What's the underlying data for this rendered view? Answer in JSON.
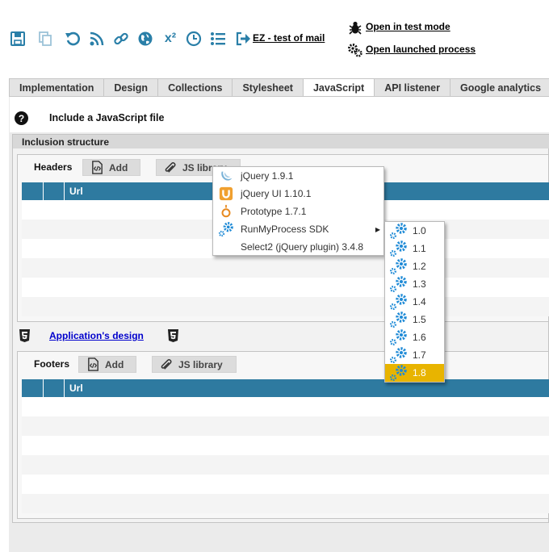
{
  "toolbar": {
    "icons": [
      "save-icon",
      "copy-icon",
      "undo-icon",
      "rss-icon",
      "link-icon",
      "globe-icon",
      "superscript-icon",
      "clock-icon",
      "list-icon",
      "export-icon"
    ],
    "superscript_label": "x²",
    "mail_link": "EZ - test of mail",
    "test_mode_link": "Open in test mode",
    "launched_process_link": "Open launched process",
    "icon_color": "#2a7fa8"
  },
  "tabs": [
    {
      "label": "Implementation"
    },
    {
      "label": "Design"
    },
    {
      "label": "Collections"
    },
    {
      "label": "Stylesheet"
    },
    {
      "label": "JavaScript",
      "active": true
    },
    {
      "label": "API listener"
    },
    {
      "label": "Google analytics"
    }
  ],
  "main": {
    "help_glyph": "?",
    "title": "Include a JavaScript file",
    "inclusion_header": "Inclusion structure",
    "headers": {
      "label": "Headers",
      "add_label": "Add",
      "js_library_label": "JS library",
      "column_url": "Url"
    },
    "design_link": "Application's design",
    "footers": {
      "label": "Footers",
      "add_label": "Add",
      "js_library_label": "JS library",
      "column_url": "Url"
    }
  },
  "menu": {
    "items": [
      {
        "label": "jQuery 1.9.1",
        "icon": "jquery-icon"
      },
      {
        "label": "jQuery UI 1.10.1",
        "icon": "jquery-ui-icon"
      },
      {
        "label": "Prototype 1.7.1",
        "icon": "prototype-icon"
      },
      {
        "label": "RunMyProcess SDK",
        "icon": "gears-icon",
        "has_submenu": true
      },
      {
        "label": "Select2 (jQuery plugin) 3.4.8",
        "icon": ""
      }
    ],
    "submenu": [
      {
        "label": "1.0"
      },
      {
        "label": "1.1"
      },
      {
        "label": "1.2"
      },
      {
        "label": "1.3"
      },
      {
        "label": "1.4"
      },
      {
        "label": "1.5"
      },
      {
        "label": "1.6"
      },
      {
        "label": "1.7"
      },
      {
        "label": "1.8",
        "highlighted": true
      }
    ],
    "highlight_color": "#e8b400"
  }
}
